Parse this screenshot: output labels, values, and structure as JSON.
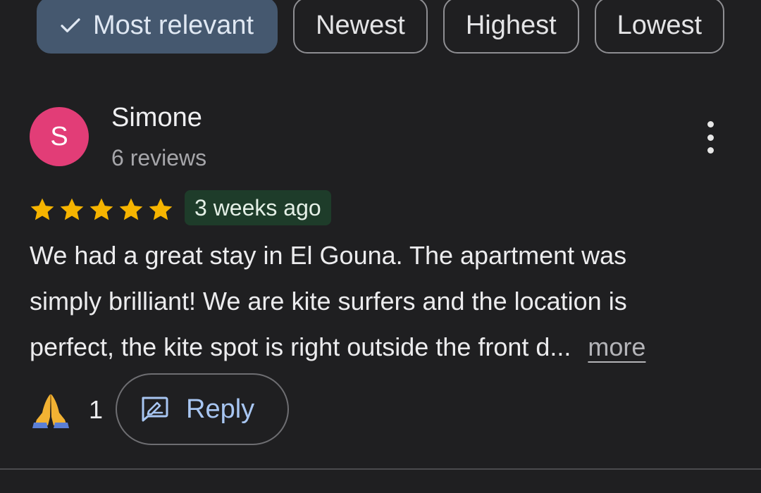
{
  "sort_chips": [
    {
      "label": "Most relevant",
      "selected": true
    },
    {
      "label": "Newest",
      "selected": false
    },
    {
      "label": "Highest",
      "selected": false
    },
    {
      "label": "Lowest",
      "selected": false
    }
  ],
  "review": {
    "avatar_initial": "S",
    "avatar_color": "#e23d77",
    "author": "Simone",
    "author_meta": "6 reviews",
    "rating": 5,
    "time_ago": "3 weeks ago",
    "text_lines": [
      "We had a great stay in El Gouna. The apartment was",
      "simply brilliant! We are kite surfers and the location is",
      "perfect, the kite spot is right outside the front d..."
    ],
    "more_label": "more",
    "reaction_icon": "praying-hands-icon",
    "reaction_count": "1",
    "reply_label": "Reply"
  },
  "colors": {
    "background": "#1f1f21",
    "selected_chip": "#45586f",
    "star": "#f6b400",
    "time_badge_bg": "#1e3c2a",
    "reply_text": "#a8c6f2"
  }
}
